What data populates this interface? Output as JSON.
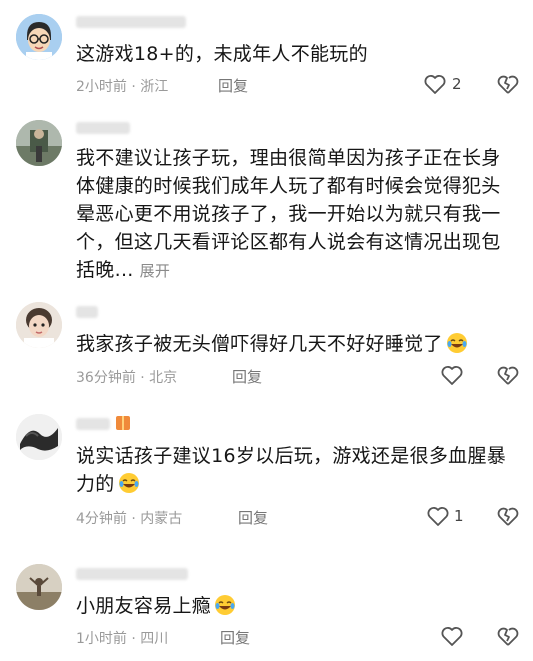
{
  "comments": [
    {
      "text": "这游戏18+的，未成年人不能玩的",
      "time_location": "2小时前 · 浙江",
      "reply_label": "回复",
      "like_count": "2"
    },
    {
      "text": "我不建议让孩子玩，理由很简单因为孩子正在长身体健康的时候我们成年人玩了都有时候会觉得犯头晕恶心更不用说孩子了，我一开始以为就只有我一个，但这几天看评论区都有人说会有这情况出现包括晚...",
      "expand_label": "展开"
    },
    {
      "text": "我家孩子被无头僧吓得好几天不好好睡觉了",
      "emoji": "laughing-crying-emoji",
      "time_location": "36分钟前 · 北京",
      "reply_label": "回复"
    },
    {
      "text": "说实话孩子建议16岁以后玩，游戏还是很多血腥暴力的",
      "emoji": "laughing-crying-emoji",
      "time_location": "4分钟前 · 内蒙古",
      "reply_label": "回复",
      "like_count": "1"
    },
    {
      "text": "小朋友容易上瘾",
      "emoji": "laughing-crying-emoji",
      "time_location": "1小时前 · 四川",
      "reply_label": "回复"
    }
  ],
  "colors": {
    "text": "#161616",
    "meta": "#9a9a9a",
    "icon": "#555555",
    "blurred_name": "#e4e4e4"
  },
  "icons": {
    "like": "heart-outline-icon",
    "dislike": "broken-heart-icon"
  }
}
